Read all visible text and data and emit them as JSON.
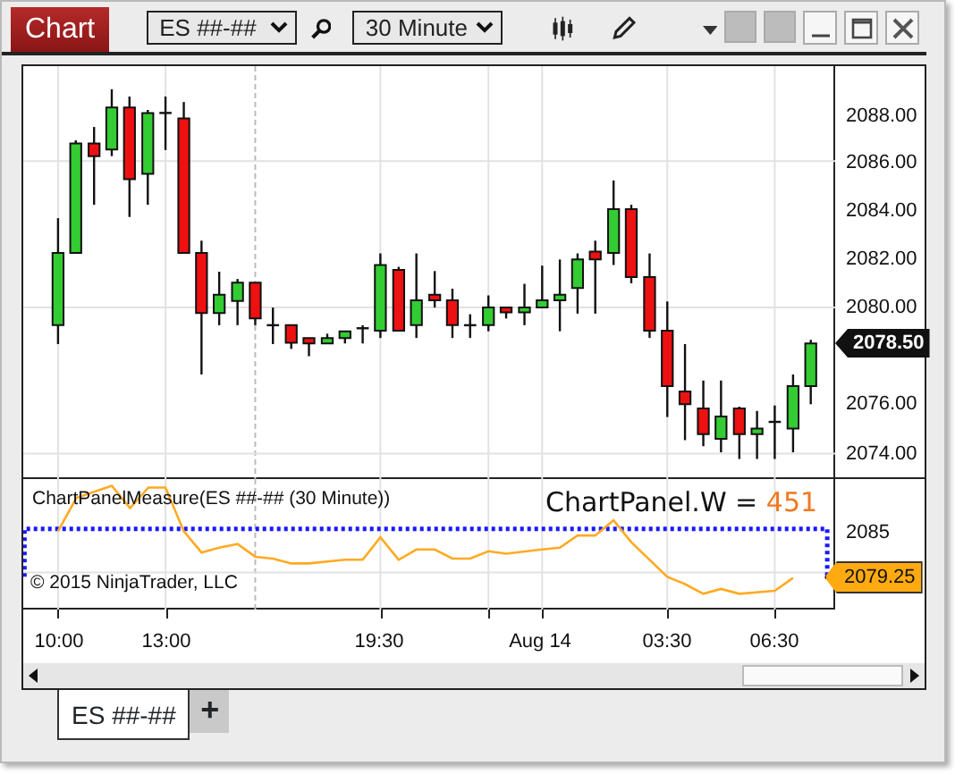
{
  "title_tab": "Chart",
  "instrument": {
    "value": "ES ##-##"
  },
  "interval": {
    "value": "30 Minute"
  },
  "price_axis": {
    "labels": [
      "2088.00",
      "2086.00",
      "2084.00",
      "2082.00",
      "2080.00",
      "2076.00",
      "2074.00"
    ],
    "last_price": "2078.50"
  },
  "indicator_panel": {
    "title": "ChartPanelMeasure(ES ##-## (30 Minute))",
    "measure_label": "ChartPanel.W =",
    "measure_value": "451",
    "axis_label": "2085",
    "last_value": "2079.25",
    "copyright": "© 2015 NinjaTrader, LLC"
  },
  "time_axis": {
    "labels": [
      "10:00",
      "13:00",
      "19:30",
      "Aug 14",
      "03:30",
      "06:30"
    ]
  },
  "tabs": [
    {
      "label": "ES ##-##",
      "selected": true
    }
  ],
  "add_tab": "+"
}
